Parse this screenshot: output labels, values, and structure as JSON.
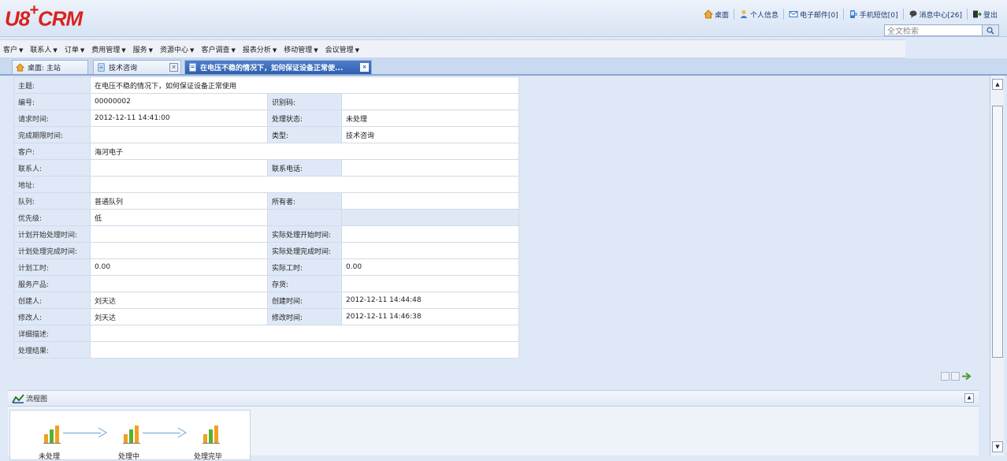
{
  "app": {
    "logo_main": "U8",
    "logo_plus": "+",
    "logo_suffix": "CRM"
  },
  "toplinks": [
    {
      "label": "桌面",
      "icon": "home-icon"
    },
    {
      "label": "个人信息",
      "icon": "person-icon"
    },
    {
      "label": "电子邮件[0]",
      "icon": "mail-icon"
    },
    {
      "label": "手机短信[0]",
      "icon": "phone-icon"
    },
    {
      "label": "消息中心[26]",
      "icon": "message-icon"
    },
    {
      "label": "登出",
      "icon": "logout-icon"
    }
  ],
  "search": {
    "placeholder": "全文检索"
  },
  "menu": [
    "客户",
    "联系人",
    "订单",
    "费用管理",
    "服务",
    "资源中心",
    "客户调查",
    "报表分析",
    "移动管理",
    "会议管理"
  ],
  "tabs": [
    {
      "label": "桌面: 主站"
    },
    {
      "label": "技术咨询"
    },
    {
      "label": "在电压不稳的情况下，如何保证设备正常使..."
    }
  ],
  "form": {
    "subject_label": "主题:",
    "subject_value": "在电压不稳的情况下，如何保证设备正常使用",
    "number_label": "编号:",
    "number_value": "00000002",
    "code_label": "识别码:",
    "code_value": "",
    "request_time_label": "请求时间:",
    "request_time_value": "2012-12-11 14:41:00",
    "status_label": "处理状态:",
    "status_value": "未处理",
    "deadline_label": "完成期限时间:",
    "deadline_value": "",
    "type_label": "类型:",
    "type_value": "技术咨询",
    "customer_label": "客户:",
    "customer_value": "海河电子",
    "contact_label": "联系人:",
    "contact_value": "",
    "phone_label": "联系电话:",
    "phone_value": "",
    "address_label": "地址:",
    "address_value": "",
    "queue_label": "队列:",
    "queue_value": "普通队列",
    "owner_label": "所有者:",
    "owner_value": "",
    "priority_label": "优先级:",
    "priority_value": "低",
    "plan_start_label": "计划开始处理时间:",
    "plan_start_value": "",
    "actual_start_label": "实际处理开始时间:",
    "actual_start_value": "",
    "plan_end_label": "计划处理完成时间:",
    "plan_end_value": "",
    "actual_end_label": "实际处理完成时间:",
    "actual_end_value": "",
    "plan_hours_label": "计划工时:",
    "plan_hours_value": "0.00",
    "actual_hours_label": "实际工时:",
    "actual_hours_value": "0.00",
    "product_label": "服务产品:",
    "product_value": "",
    "stock_label": "存货:",
    "stock_value": "",
    "creator_label": "创建人:",
    "creator_value": "刘天达",
    "created_label": "创建时间:",
    "created_value": "2012-12-11 14:44:48",
    "modifier_label": "修改人:",
    "modifier_value": "刘天达",
    "modified_label": "修改时间:",
    "modified_value": "2012-12-11 14:46:38",
    "detail_label": "详细描述:",
    "detail_value": "",
    "result_label": "处理结果:",
    "result_value": ""
  },
  "flow": {
    "title": "流程图",
    "steps": [
      "未处理",
      "处理中",
      "处理完毕"
    ]
  },
  "colors": {
    "logo": "#d9221c",
    "accent": "#2e5fae"
  }
}
